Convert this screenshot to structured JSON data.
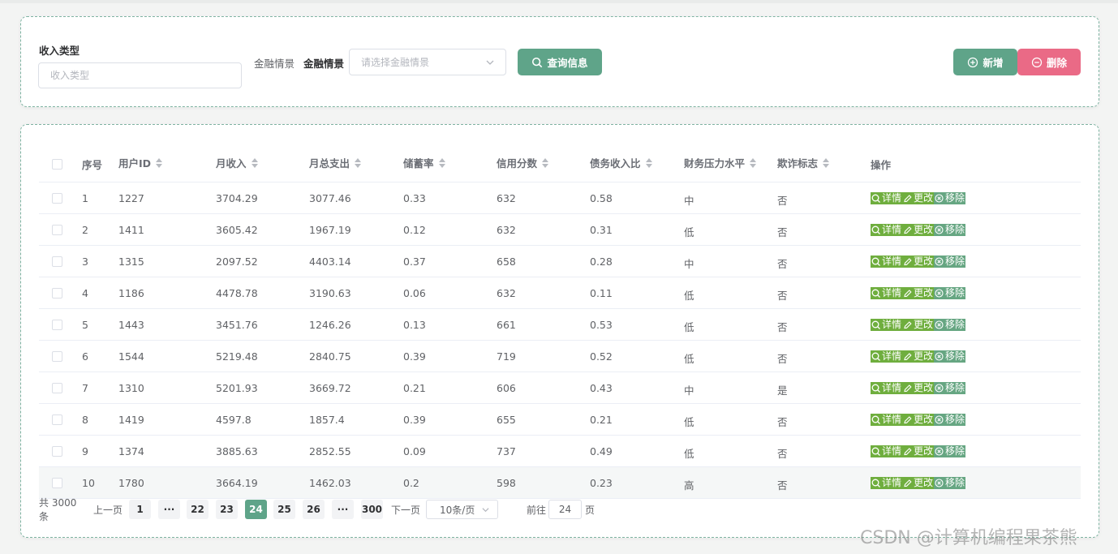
{
  "filters": {
    "income_type_label": "收入类型",
    "income_type_placeholder": "收入类型",
    "financial_label_1": "金融情景",
    "financial_label_2": "金融情景",
    "financial_placeholder": "请选择金融情景",
    "query_button": "查询信息",
    "add_button": "新增",
    "delete_button": "删除"
  },
  "table": {
    "columns": [
      "序号",
      "用户ID",
      "月收入",
      "月总支出",
      "储蓄率",
      "信用分数",
      "债务收入比",
      "财务压力水平",
      "欺诈标志",
      "操作"
    ],
    "rows": [
      [
        "1",
        "1227",
        "3704.29",
        "3077.46",
        "0.33",
        "632",
        "0.58",
        "中",
        "否"
      ],
      [
        "2",
        "1411",
        "3605.42",
        "1967.19",
        "0.12",
        "632",
        "0.31",
        "低",
        "否"
      ],
      [
        "3",
        "1315",
        "2097.52",
        "4403.14",
        "0.37",
        "658",
        "0.28",
        "中",
        "否"
      ],
      [
        "4",
        "1186",
        "4478.78",
        "3190.63",
        "0.06",
        "632",
        "0.11",
        "低",
        "否"
      ],
      [
        "5",
        "1443",
        "3451.76",
        "1246.26",
        "0.13",
        "661",
        "0.53",
        "低",
        "否"
      ],
      [
        "6",
        "1544",
        "5219.48",
        "2840.75",
        "0.39",
        "719",
        "0.52",
        "低",
        "否"
      ],
      [
        "7",
        "1310",
        "5201.93",
        "3669.72",
        "0.21",
        "606",
        "0.43",
        "中",
        "是"
      ],
      [
        "8",
        "1419",
        "4597.8",
        "1857.4",
        "0.39",
        "655",
        "0.21",
        "低",
        "否"
      ],
      [
        "9",
        "1374",
        "3885.63",
        "2852.55",
        "0.09",
        "737",
        "0.49",
        "低",
        "否"
      ],
      [
        "10",
        "1780",
        "3664.19",
        "1462.03",
        "0.2",
        "598",
        "0.23",
        "高",
        "否"
      ]
    ],
    "actions": [
      "详情",
      "更改",
      "移除"
    ]
  },
  "pagination": {
    "total": "共 3000 条",
    "prev": "上一页",
    "pages": [
      "1",
      "···",
      "22",
      "23",
      "24",
      "25",
      "26",
      "···",
      "300"
    ],
    "active_page": "24",
    "next": "下一页",
    "page_size": "10条/页",
    "goto_label": "前往",
    "goto_value": "24",
    "goto_suffix": "页"
  },
  "watermark": "CSDN @计算机编程果茶熊",
  "colors": {
    "primary": "#5fa489",
    "danger": "#ea6a86",
    "action": "#6fae3e"
  }
}
